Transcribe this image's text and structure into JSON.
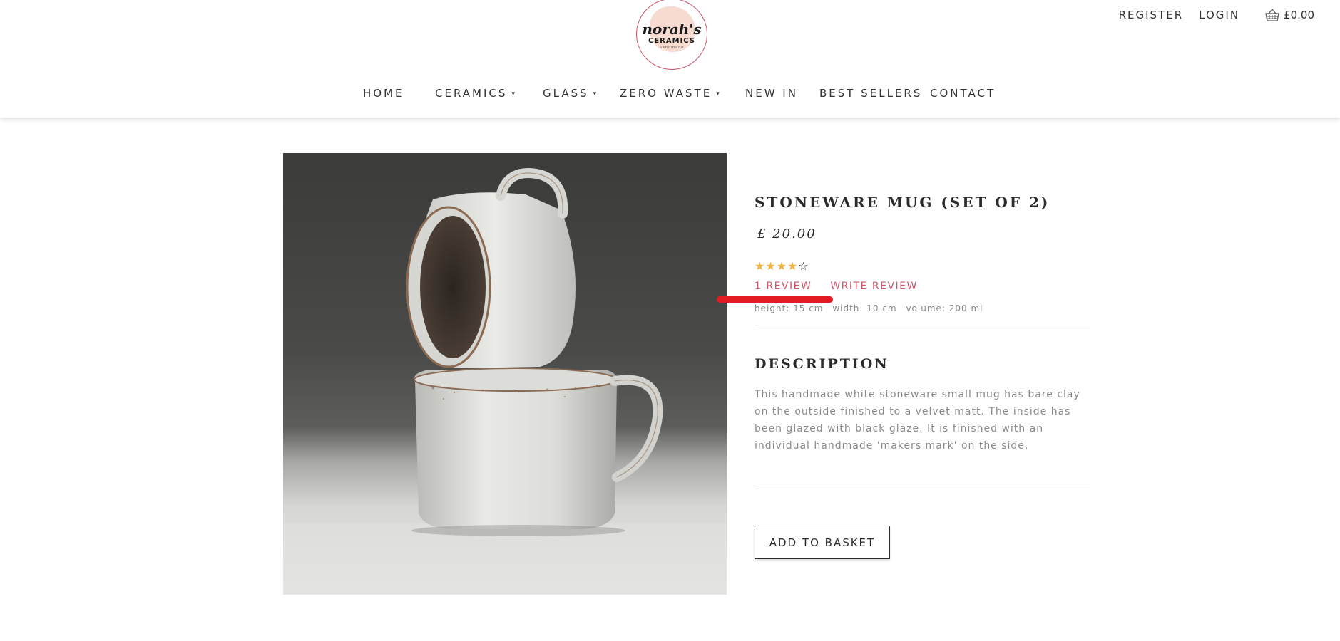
{
  "header": {
    "logo": {
      "name": "norah's",
      "sub": "CERAMICS",
      "tag": "handmade"
    },
    "top_links": {
      "register": "REGISTER",
      "login": "LOGIN"
    },
    "basket": {
      "icon": "basket-icon",
      "amount": "£0.00"
    }
  },
  "nav": {
    "items": [
      {
        "label": "HOME",
        "has_dropdown": false
      },
      {
        "label": "CERAMICS",
        "has_dropdown": true
      },
      {
        "label": "GLASS",
        "has_dropdown": true
      },
      {
        "label": "ZERO WASTE",
        "has_dropdown": true
      },
      {
        "label": "NEW IN",
        "has_dropdown": false
      },
      {
        "label": "BEST SELLERS",
        "has_dropdown": false
      },
      {
        "label": "CONTACT",
        "has_dropdown": false
      }
    ],
    "caret": "▾"
  },
  "product": {
    "title": "STONEWARE MUG (SET OF 2)",
    "price": "£ 20.00",
    "rating": 4,
    "rating_max": 5,
    "reviews_link": "1 REVIEW",
    "write_review": "WRITE REVIEW",
    "dimensions": {
      "height": "height: 15 cm",
      "width": "width: 10 cm",
      "volume": "volume: 200 ml"
    },
    "description_title": "DESCRIPTION",
    "description": "This handmade white stoneware small mug has bare clay on the outside finished to a velvet matt. The inside has been glazed with black glaze. It is finished with an individual handmade 'makers mark' on the side.",
    "add_to_basket": "ADD TO BASKET"
  },
  "colors": {
    "accent": "#c9596b",
    "star": "#f2b33d",
    "annotation": "#e31c23",
    "text": "#2b2b2b",
    "muted": "#8a8a8a"
  }
}
